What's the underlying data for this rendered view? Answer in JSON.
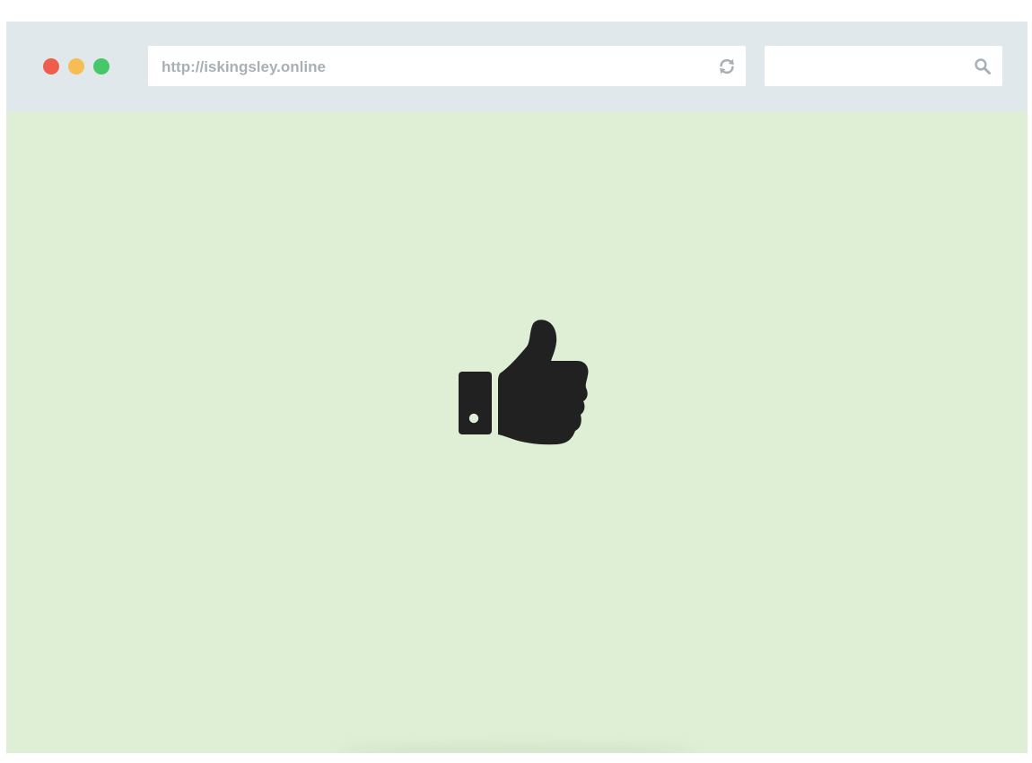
{
  "window": {
    "traffic_lights": {
      "close_color": "#ef5e4c",
      "minimize_color": "#f7bd52",
      "zoom_color": "#46c869"
    }
  },
  "toolbar": {
    "address": "http://iskingsley.online",
    "reload_icon": "reload-icon",
    "search_value": "",
    "search_icon": "magnifier-icon"
  },
  "content": {
    "background": "#dfefd6",
    "illustration": "thumbs-up-icon"
  }
}
